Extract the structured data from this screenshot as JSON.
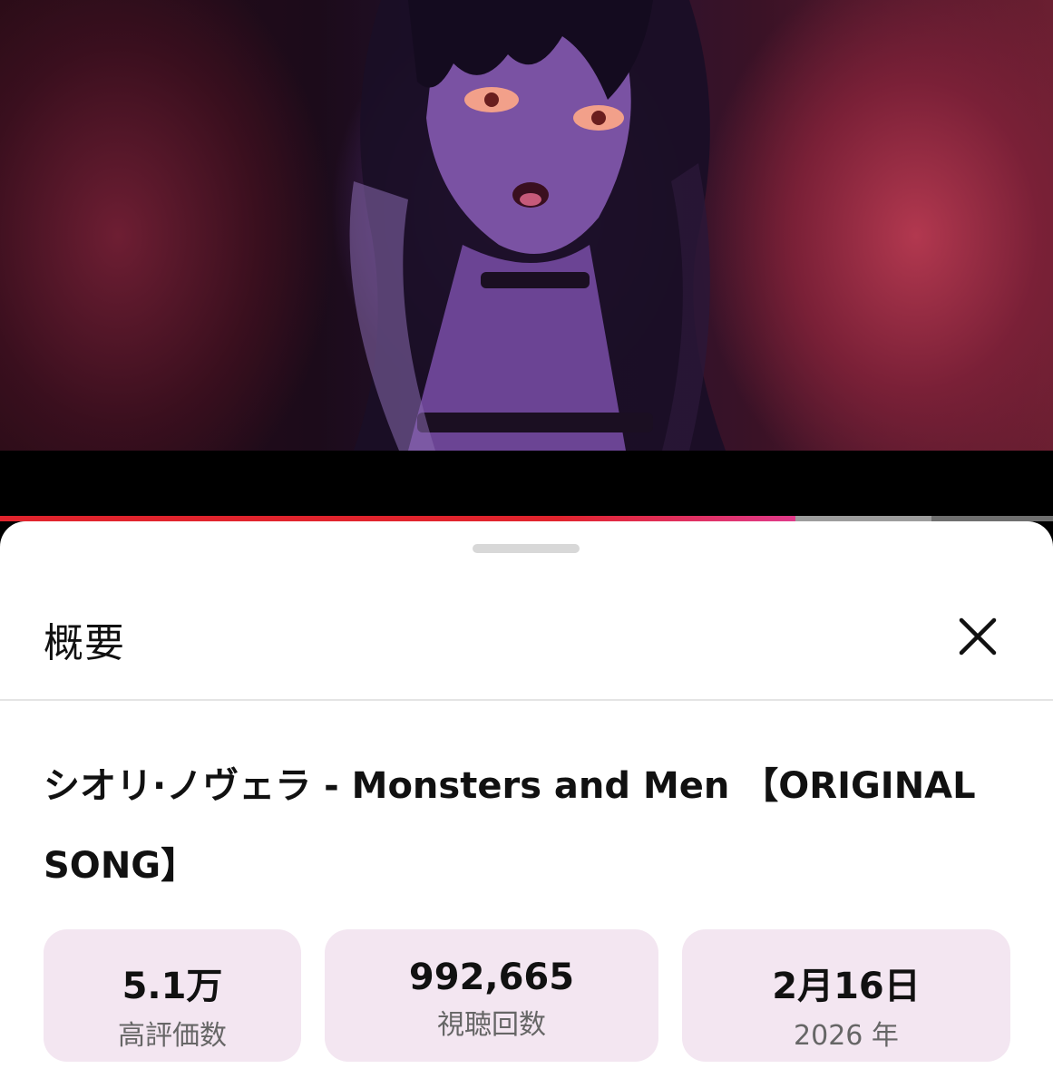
{
  "player": {
    "progress_fraction": 0.755,
    "buffer_fraction": 0.885,
    "colors": {
      "played": "#e1242d",
      "played_end": "#e03a8a",
      "buffered": "#9d9d9d",
      "track": "#6f6f6f"
    }
  },
  "sheet": {
    "title": "概要",
    "close_icon": "close-icon"
  },
  "video": {
    "title": "シオリ·ノヴェラ - Monsters and Men 【ORIGINAL SONG】"
  },
  "stats": {
    "likes": {
      "value": "5.1万",
      "label": "高評価数"
    },
    "views": {
      "value": "992,665",
      "label": "視聴回数"
    },
    "date": {
      "value": "2月16日",
      "label": "2026 年"
    },
    "card_color": "#f3e6f1"
  }
}
